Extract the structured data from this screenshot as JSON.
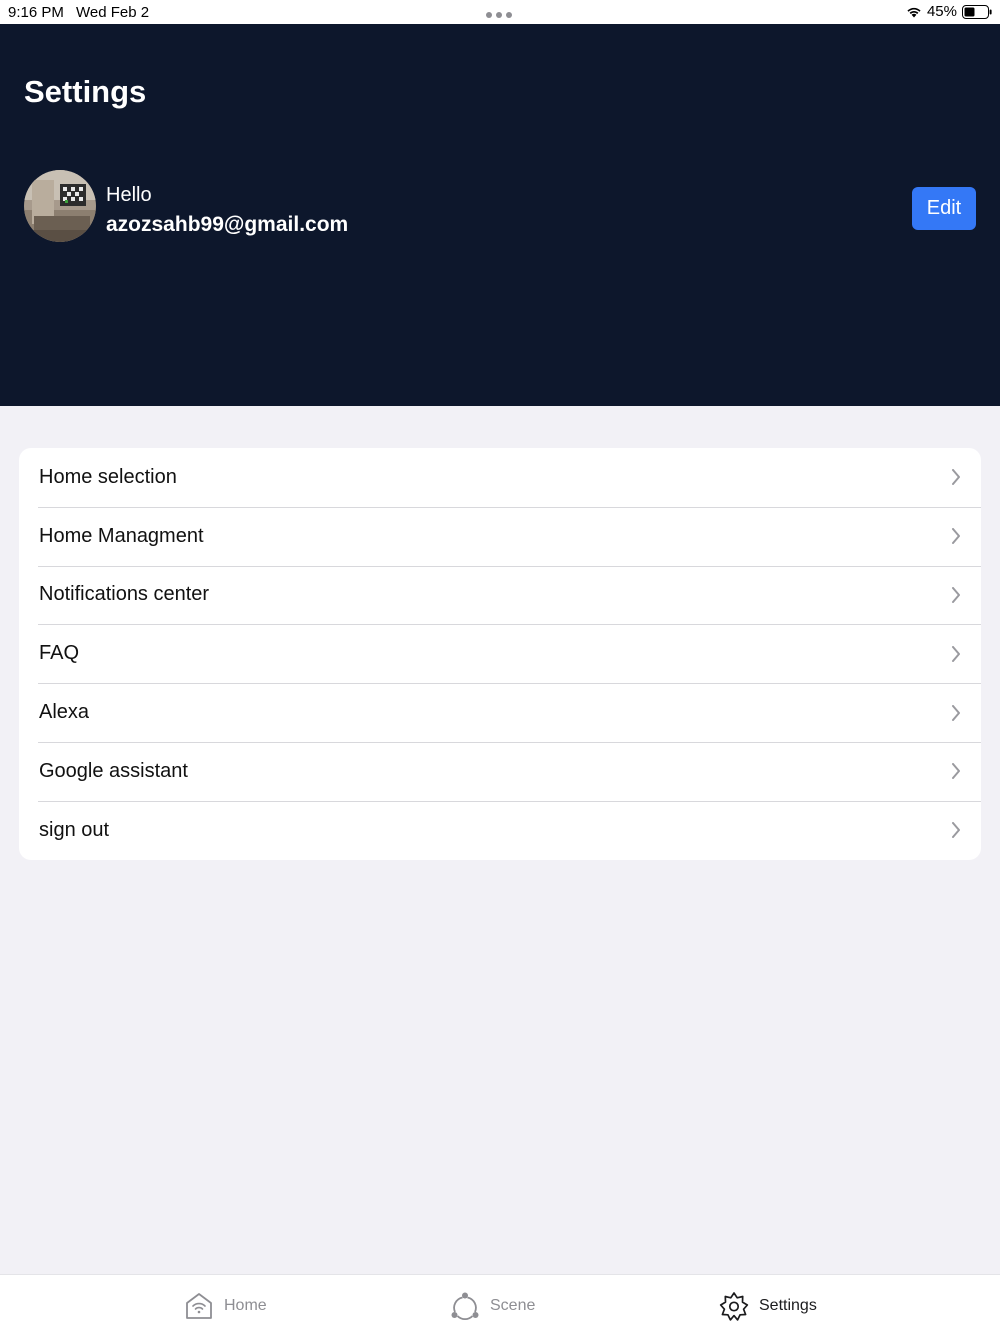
{
  "status_bar": {
    "time": "9:16 PM",
    "date": "Wed Feb 2",
    "battery": "45%",
    "icons": [
      "multitask-dots-icon",
      "wifi-icon",
      "battery-icon"
    ]
  },
  "header": {
    "title": "Settings",
    "greeting": "Hello",
    "email": "azozsahb99@gmail.com",
    "edit_label": "Edit"
  },
  "settings": {
    "items": [
      {
        "label": "Home selection"
      },
      {
        "label": "Home Managment"
      },
      {
        "label": "Notifications center"
      },
      {
        "label": "FAQ"
      },
      {
        "label": "Alexa"
      },
      {
        "label": "Google assistant"
      },
      {
        "label": "sign out"
      }
    ]
  },
  "tab_bar": {
    "tabs": [
      {
        "label": "Home",
        "icon": "home-wifi-icon",
        "active": false
      },
      {
        "label": "Scene",
        "icon": "scene-icon",
        "active": false
      },
      {
        "label": "Settings",
        "icon": "gear-icon",
        "active": true
      }
    ]
  },
  "colors": {
    "header_bg": "#0d172c",
    "accent": "#3478f6",
    "page_bg": "#f2f1f6"
  }
}
